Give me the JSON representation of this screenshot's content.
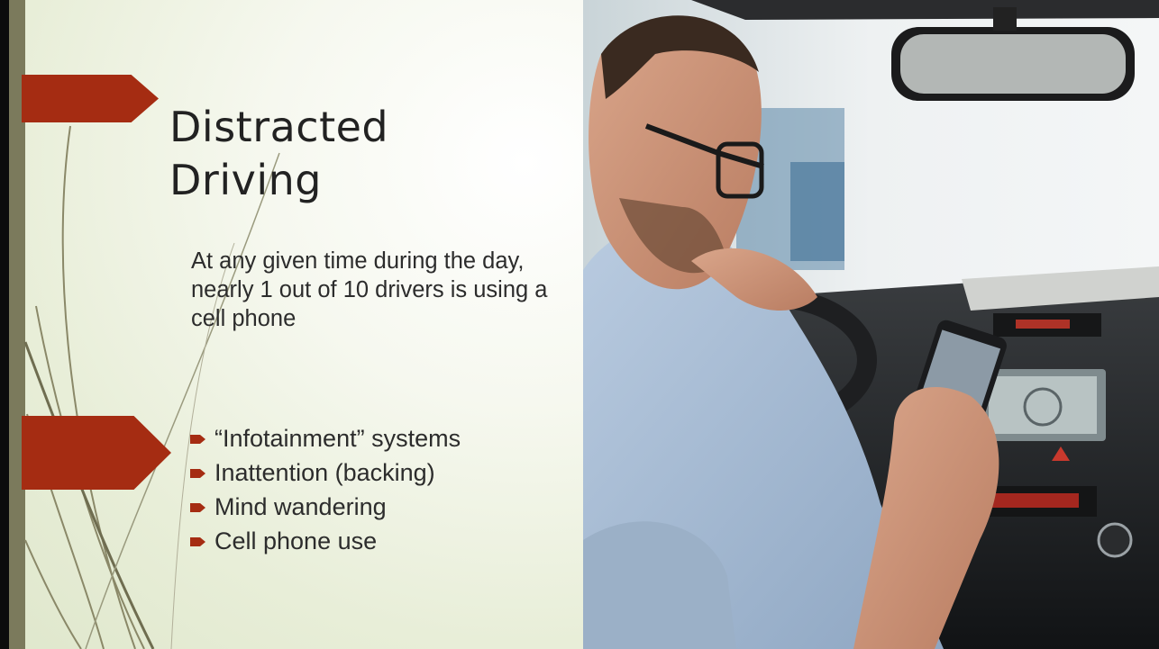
{
  "slide": {
    "title_line1": "Distracted",
    "title_line2": "Driving",
    "intro": "At any given time during the day, nearly 1 out of 10 drivers is using a cell phone",
    "bullets": [
      "“Infotainment” systems",
      "Inattention (backing)",
      "Mind wandering",
      "Cell phone use"
    ]
  },
  "theme": {
    "accent": "#a52c12",
    "stripe": "#7b7a5c",
    "background": "#eef2e2",
    "text": "#222222"
  },
  "photo": {
    "subject": "man-texting-while-driving"
  }
}
